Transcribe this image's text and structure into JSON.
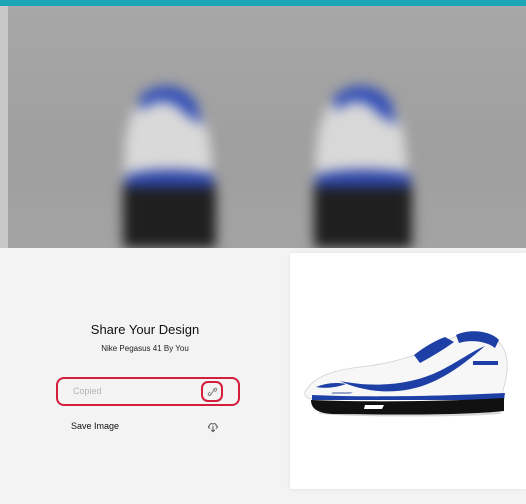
{
  "accent_color": "#1aa6b7",
  "share": {
    "title": "Share Your Design",
    "subtitle": "Nike Pegasus 41 By You",
    "copy_field_text": "Copied",
    "copy_icon": "link-icon",
    "save_label": "Save Image",
    "save_icon": "download-icon"
  },
  "colors": {
    "highlight_red": "#d21e3c",
    "shoe_blue": "#1e3fa6",
    "sole_black": "#111111"
  }
}
